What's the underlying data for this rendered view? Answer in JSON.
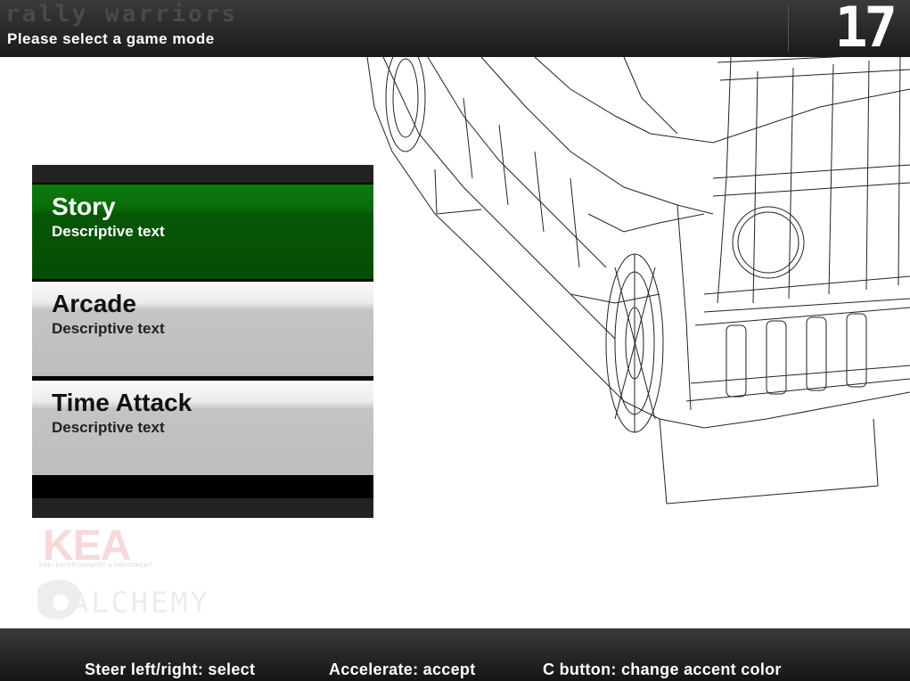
{
  "header": {
    "game_title": "rally warriors",
    "subtitle": "Please select a game mode",
    "timer": "17"
  },
  "menu": {
    "items": [
      {
        "title": "Story",
        "description": "Descriptive text",
        "selected": true
      },
      {
        "title": "Arcade",
        "description": "Descriptive text",
        "selected": false
      },
      {
        "title": "Time Attack",
        "description": "Descriptive text",
        "selected": false
      }
    ],
    "accent_color": "#0a6a0a"
  },
  "logos": {
    "kea": "KEA",
    "kea_sub": "KOEI ENTERTAINMENT & AMUSEMENT",
    "alchemy": "ALCHEMY"
  },
  "controls": {
    "select": "Steer left/right: select",
    "accept": "Accelerate: accept",
    "accent": "C button: change accent color"
  },
  "background": {
    "image": "wireframe-car-icon"
  }
}
